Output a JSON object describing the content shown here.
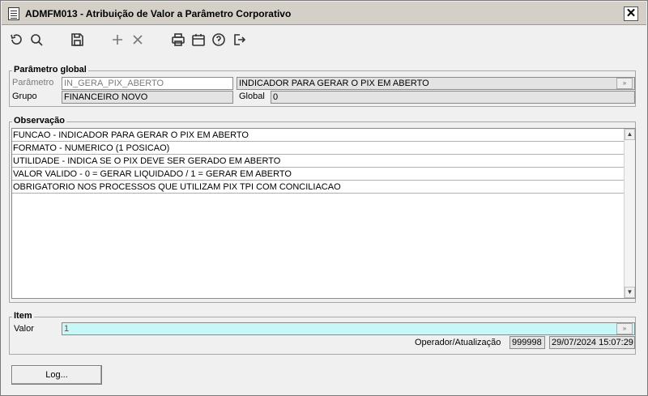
{
  "window": {
    "title": "ADMFM013 - Atribuição de Valor a Parâmetro Corporativo",
    "close_glyph": "✕"
  },
  "toolbar": {
    "icons": [
      "undo-icon",
      "search-icon",
      "save-icon",
      "add-icon",
      "delete-icon",
      "print-icon",
      "calendar-icon",
      "help-icon",
      "exit-icon"
    ]
  },
  "parametro_global": {
    "title": "Parâmetro global",
    "parametro_label": "Parâmetro",
    "parametro_value": "IN_GERA_PIX_ABERTO",
    "descricao_value": "INDICADOR PARA GERAR O PIX EM ABERTO",
    "grupo_label": "Grupo",
    "grupo_value": "FINANCEIRO NOVO",
    "global_label": "Global",
    "global_value": "0"
  },
  "observacao": {
    "title": "Observação",
    "lines": [
      "FUNCAO - INDICADOR PARA GERAR O PIX EM ABERTO",
      "FORMATO - NUMERICO (1 POSICAO)",
      "UTILIDADE - INDICA SE O PIX DEVE SER GERADO EM ABERTO",
      "VALOR VALIDO - 0 = GERAR LIQUIDADO  / 1 = GERAR EM ABERTO",
      "OBRIGATORIO NOS PROCESSOS QUE UTILIZAM PIX TPI COM CONCILIACAO"
    ]
  },
  "item": {
    "title": "Item",
    "valor_label": "Valor",
    "valor_value": "1",
    "operador_label": "Operador/Atualização",
    "operador_value": "999998",
    "atualizacao_value": "29/07/2024 15:07:29"
  },
  "footer": {
    "log_label": "Log..."
  },
  "colors": {
    "valor_field_bg": "#c8f7f7",
    "readonly_bg": "#e3e3e3"
  }
}
